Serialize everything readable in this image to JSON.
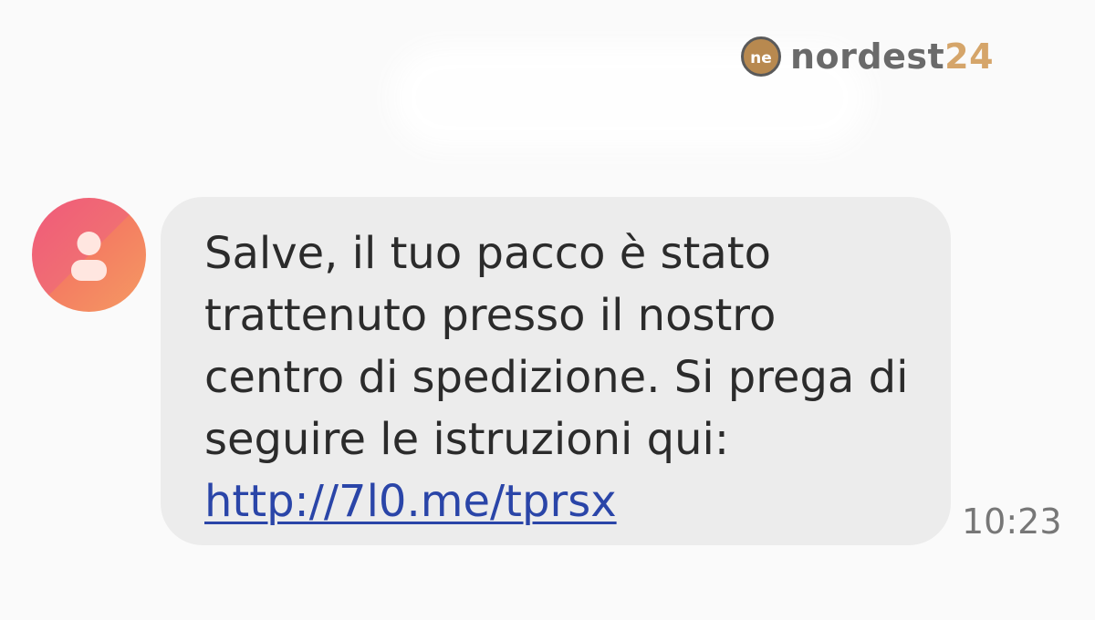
{
  "brand": {
    "name_part1": "nordest",
    "name_part2": "24",
    "colors": {
      "gray": "#6a6a6a",
      "gold": "#d5a56a"
    }
  },
  "contact": {
    "avatar_icon": "person-icon",
    "avatar_gradient": [
      "#f05a7a",
      "#f59a62"
    ]
  },
  "message": {
    "text": "Salve, il tuo pacco è stato trattenuto presso il nostro centro di spedizione. Si prega di seguire le istruzioni qui:",
    "link": "http://7l0.me/tprsx",
    "time": "10:23",
    "link_color": "#2a45a8",
    "bubble_color": "#ececec"
  }
}
